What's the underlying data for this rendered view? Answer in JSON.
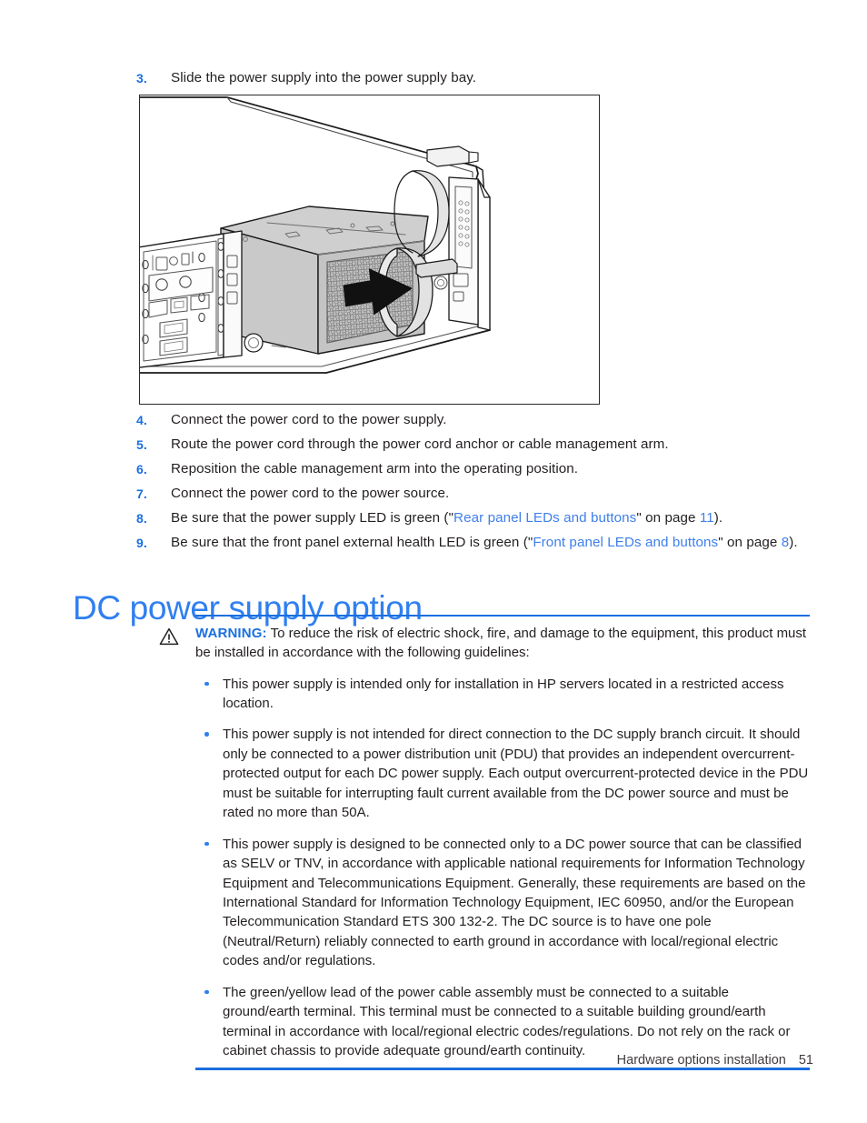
{
  "document": {
    "steps_before_figure": [
      {
        "num": "3.",
        "text": "Slide the power supply into the power supply bay."
      }
    ],
    "figure": {
      "caption": "",
      "alt_name": "power-supply-installation-illustration"
    },
    "steps_after_figure": [
      {
        "num": "4.",
        "text": "Connect the power cord to the power supply."
      },
      {
        "num": "5.",
        "text": "Route the power cord through the power cord anchor or cable management arm."
      },
      {
        "num": "6.",
        "text": "Reposition the cable management arm into the operating position."
      },
      {
        "num": "7.",
        "text": "Connect the power cord to the power source."
      }
    ],
    "step8": {
      "num": "8.",
      "lead": "Be sure that the power supply LED is green (\"",
      "link": "Rear panel LEDs and buttons",
      "mid": "\" on page ",
      "page": "11",
      "tail": ")."
    },
    "step9": {
      "num": "9.",
      "lead": "Be sure that the front panel external health LED is green (\"",
      "link": "Front panel LEDs and buttons",
      "mid": "\" on page ",
      "page": "8",
      "tail": ")."
    },
    "heading": "DC power supply option",
    "warning": {
      "icon": "warning-triangle-icon",
      "label": "WARNING:",
      "intro": " To reduce the risk of electric shock, fire, and damage to the equipment, this product must be installed in accordance with the following guidelines:",
      "bullets": [
        "This power supply is intended only for installation in HP servers located in a restricted access location.",
        "This power supply is not intended for direct connection to the DC supply branch circuit. It should only be connected to a power distribution unit (PDU) that provides an independent overcurrent-protected output for each DC power supply. Each output overcurrent-protected device in the PDU must be suitable for interrupting fault current available from the DC power source and must be rated no more than 50A.",
        "This power supply is designed to be connected only to a DC power source that can be classified as SELV or TNV, in accordance with applicable national requirements for Information Technology Equipment and Telecommunications Equipment. Generally, these requirements are based on the International Standard for Information Technology Equipment, IEC 60950, and/or the European Telecommunication Standard ETS 300 132-2. The DC source is to have one pole (Neutral/Return) reliably connected to earth ground in accordance with local/regional electric codes and/or regulations.",
        "The green/yellow lead of the power cable assembly must be connected to a suitable ground/earth terminal. This terminal must be connected to a suitable building ground/earth terminal in accordance with local/regional electric codes/regulations. Do not rely on the rack or cabinet chassis to provide adequate ground/earth continuity."
      ]
    },
    "footer": {
      "chapter": "Hardware options installation",
      "page_number": "51"
    },
    "colors": {
      "link_blue": "#3f7fea",
      "heading_blue": "#2f7ff0",
      "number_blue": "#1a6fe0",
      "rule_blue": "#1a6fe0",
      "body_text": "#231f20"
    }
  }
}
